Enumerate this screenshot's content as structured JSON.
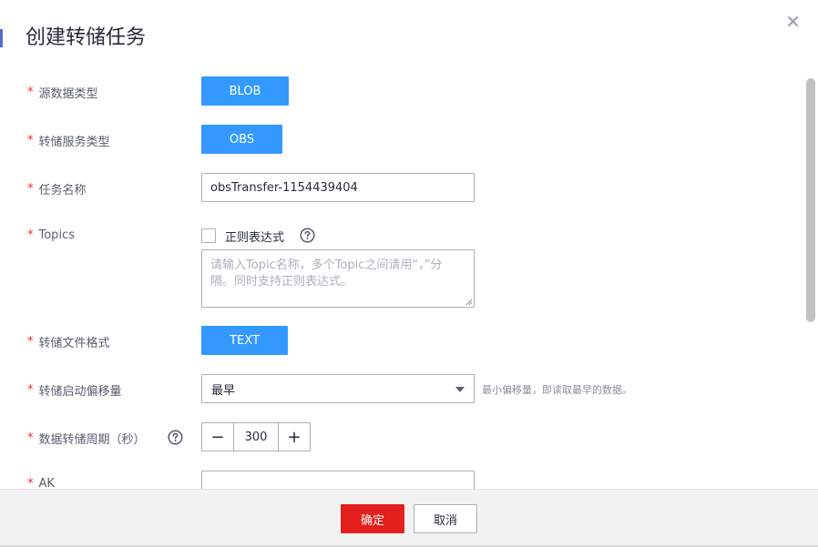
{
  "dialog": {
    "title": "创建转储任务",
    "close_icon": "close-icon"
  },
  "form": {
    "source_type": {
      "label": "源数据类型",
      "value": "BLOB"
    },
    "dump_service_type": {
      "label": "转储服务类型",
      "value": "OBS"
    },
    "task_name": {
      "label": "任务名称",
      "value": "obsTransfer-1154439404"
    },
    "topics": {
      "label": "Topics",
      "regex_label": "正则表达式",
      "regex_checked": false,
      "placeholder": "请输入Topic名称，多个Topic之间请用“，”分隔。同时支持正则表达式。"
    },
    "file_format": {
      "label": "转储文件格式",
      "value": "TEXT"
    },
    "start_offset": {
      "label": "转储启动偏移量",
      "selected": "最早",
      "hint": "最小偏移量，即读取最早的数据。"
    },
    "dump_period": {
      "label": "数据转储周期（秒）",
      "value": "300",
      "minus": "−",
      "plus": "+"
    },
    "ak": {
      "label": "AK",
      "value": ""
    }
  },
  "footer": {
    "confirm_label": "确定",
    "cancel_label": "取消"
  },
  "colors": {
    "primary": "#3399ff",
    "danger": "#e4201f",
    "required": "#f5222d",
    "accent": "#526ecc"
  }
}
